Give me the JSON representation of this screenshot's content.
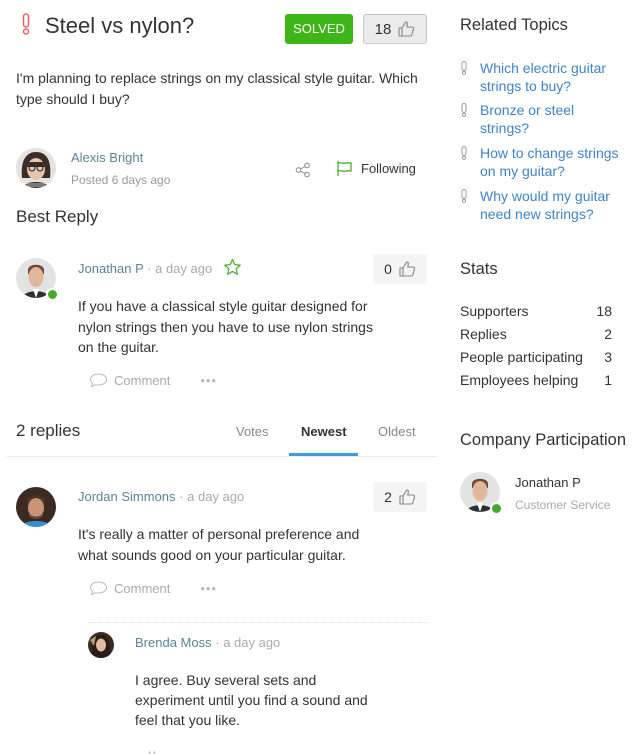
{
  "question": {
    "title": "Steel vs nylon?",
    "status_badge": "SOLVED",
    "votes": "18",
    "body": "I'm planning to replace strings on my classical style guitar. Which type should I buy?",
    "author": "Alexis Bright",
    "posted": "Posted 6 days ago",
    "follow_label": "Following",
    "icon": "exclamation-icon"
  },
  "best_reply": {
    "section_title": "Best Reply",
    "author": "Jonathan P",
    "separator": "·",
    "time": "a day ago",
    "votes": "0",
    "text": "If you have a classical style guitar designed for nylon strings then you have to use nylon strings on the guitar.",
    "comment_label": "Comment",
    "more_label": "•••"
  },
  "replies": {
    "count_label": "2 replies",
    "tabs": [
      {
        "label": "Votes",
        "active": false
      },
      {
        "label": "Newest",
        "active": true
      },
      {
        "label": "Oldest",
        "active": false
      }
    ],
    "items": [
      {
        "author": "Jordan Simmons",
        "separator": "·",
        "time": "a day ago",
        "votes": "2",
        "text": "It's really a matter of personal preference and what sounds good on your particular guitar.",
        "comment_label": "Comment",
        "more_label": "•••",
        "sub_replies": [
          {
            "author": "Brenda Moss",
            "separator": "·",
            "time": "a day ago",
            "text": "I agree. Buy several sets and experiment until you find a sound and feel that you like."
          }
        ]
      }
    ]
  },
  "sidebar": {
    "related_title": "Related Topics",
    "related": [
      "Which electric guitar strings to buy?",
      "Bronze or steel strings?",
      "How to change strings on my guitar?",
      "Why would my guitar need new strings?"
    ],
    "stats_title": "Stats",
    "stats": [
      {
        "label": "Supporters",
        "value": "18"
      },
      {
        "label": "Replies",
        "value": "2"
      },
      {
        "label": "People participating",
        "value": "3"
      },
      {
        "label": "Employees helping",
        "value": "1"
      }
    ],
    "company_title": "Company Participation",
    "company_member": {
      "name": "Jonathan P",
      "role": "Customer Service"
    }
  },
  "colors": {
    "solved": "#3fb618",
    "link": "#3e84c8",
    "author": "#5a8596",
    "tab_active": "#3f9bd9",
    "online": "#45a92a",
    "question_icon": "#e8645a"
  }
}
